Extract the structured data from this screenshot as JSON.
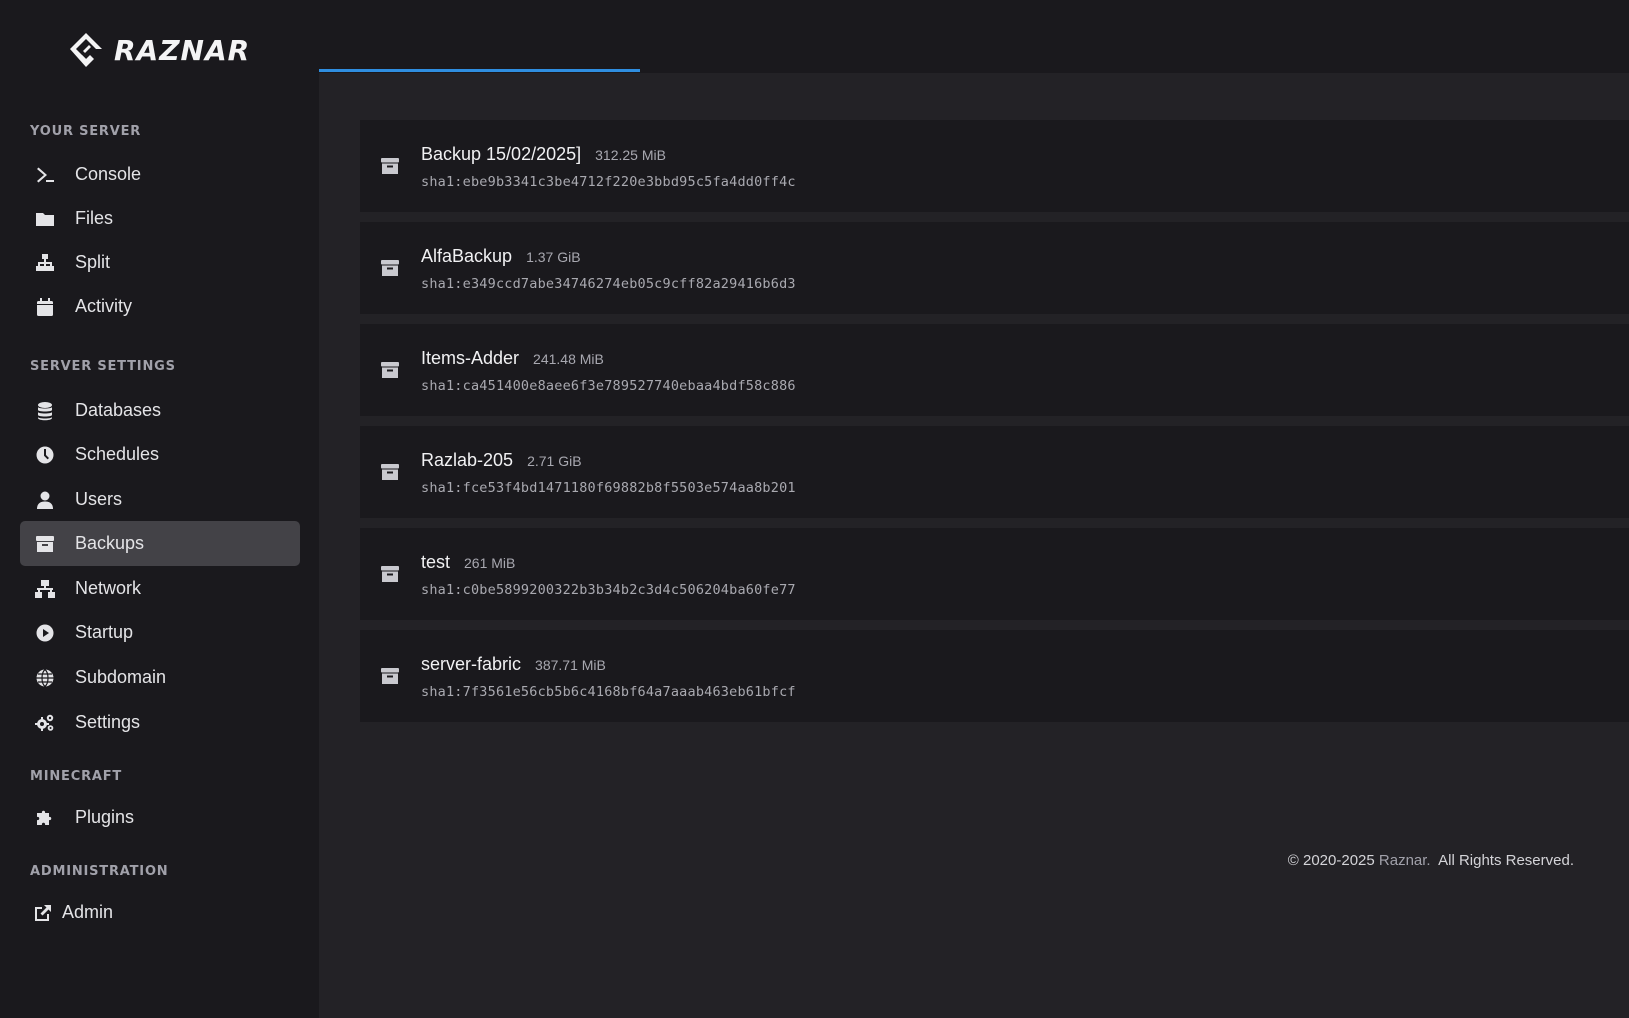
{
  "brand": {
    "name": "RAZNAR"
  },
  "sidebar": {
    "sections": {
      "your_server": "YOUR SERVER",
      "server_settings": "SERVER SETTINGS",
      "minecraft": "MINECRAFT",
      "administration": "ADMINISTRATION"
    },
    "items": {
      "console": "Console",
      "files": "Files",
      "split": "Split",
      "activity": "Activity",
      "databases": "Databases",
      "schedules": "Schedules",
      "users": "Users",
      "backups": "Backups",
      "network": "Network",
      "startup": "Startup",
      "subdomain": "Subdomain",
      "settings": "Settings",
      "plugins": "Plugins",
      "admin": "Admin"
    },
    "active_item": "backups"
  },
  "backups": [
    {
      "name": "Backup 15/02/2025]",
      "size": "312.25 MiB",
      "hash": "sha1:ebe9b3341c3be4712f220e3bbd95c5fa4dd0ff4c"
    },
    {
      "name": "AlfaBackup",
      "size": "1.37 GiB",
      "hash": "sha1:e349ccd7abe34746274eb05c9cff82a29416b6d3"
    },
    {
      "name": "Items-Adder",
      "size": "241.48 MiB",
      "hash": "sha1:ca451400e8aee6f3e789527740ebaa4bdf58c886"
    },
    {
      "name": "Razlab-205",
      "size": "2.71 GiB",
      "hash": "sha1:fce53f4bd1471180f69882b8f5503e574aa8b201"
    },
    {
      "name": "test",
      "size": "261 MiB",
      "hash": "sha1:c0be5899200322b3b34b2c3d4c506204ba60fe77"
    },
    {
      "name": "server-fabric",
      "size": "387.71 MiB",
      "hash": "sha1:7f3561e56cb5b6c4168bf64a7aaab463eb61bfcf"
    }
  ],
  "footer": {
    "prefix": "© 2020-2025 ",
    "brand": "Raznar.",
    "suffix": "  All Rights Reserved."
  },
  "colors": {
    "accent": "#2f8ee0",
    "sidebar_bg": "#1a191d",
    "content_bg": "#232226",
    "active_item_bg": "#434247"
  }
}
